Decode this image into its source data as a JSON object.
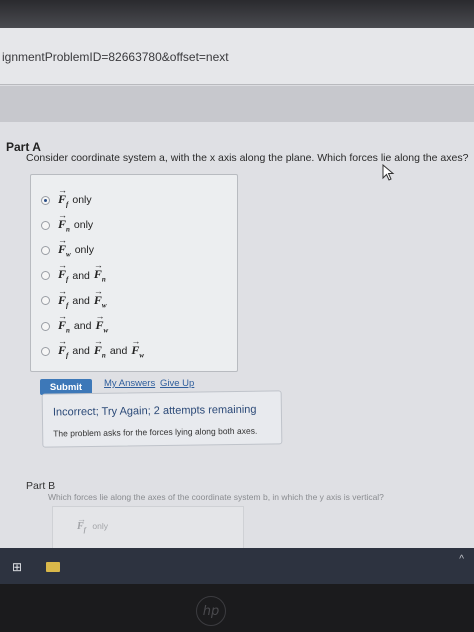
{
  "browser": {
    "url": "ignmentProblemID=82663780&offset=next"
  },
  "part_a": {
    "label": "Part A",
    "question": "Consider coordinate system a, with the x axis along the plane. Which forces lie along the axes?",
    "options": [
      {
        "vectors": [
          {
            "sym": "F",
            "sub": "f"
          }
        ],
        "connectors": [
          "only"
        ],
        "selected": true
      },
      {
        "vectors": [
          {
            "sym": "F",
            "sub": "n"
          }
        ],
        "connectors": [
          "only"
        ],
        "selected": false
      },
      {
        "vectors": [
          {
            "sym": "F",
            "sub": "w"
          }
        ],
        "connectors": [
          "only"
        ],
        "selected": false
      },
      {
        "vectors": [
          {
            "sym": "F",
            "sub": "f"
          },
          {
            "sym": "F",
            "sub": "n"
          }
        ],
        "connectors": [
          "and"
        ],
        "selected": false
      },
      {
        "vectors": [
          {
            "sym": "F",
            "sub": "f"
          },
          {
            "sym": "F",
            "sub": "w"
          }
        ],
        "connectors": [
          "and"
        ],
        "selected": false
      },
      {
        "vectors": [
          {
            "sym": "F",
            "sub": "n"
          },
          {
            "sym": "F",
            "sub": "w"
          }
        ],
        "connectors": [
          "and"
        ],
        "selected": false
      },
      {
        "vectors": [
          {
            "sym": "F",
            "sub": "f"
          },
          {
            "sym": "F",
            "sub": "n"
          },
          {
            "sym": "F",
            "sub": "w"
          }
        ],
        "connectors": [
          "and",
          "and"
        ],
        "selected": false
      }
    ],
    "submit_label": "Submit",
    "my_answers_label": "My Answers",
    "give_up_label": "Give Up",
    "feedback_title": "Incorrect; Try Again; 2 attempts remaining",
    "feedback_message": "The problem asks for the forces lying along both axes."
  },
  "part_b": {
    "label": "Part B",
    "question": "Which forces lie along the axes of the coordinate system b, in which the y axis is vertical?",
    "first_option": {
      "vector": {
        "sym": "F",
        "sub": "f"
      },
      "text": "only"
    }
  },
  "device": {
    "logo": "hp"
  },
  "icons": {
    "arrow": "→",
    "windows": "⊞",
    "chevron": "^"
  },
  "colors": {
    "submit_bg": "#3d78b8",
    "link": "#2f5e9c",
    "feedback_title": "#2c4a78"
  }
}
